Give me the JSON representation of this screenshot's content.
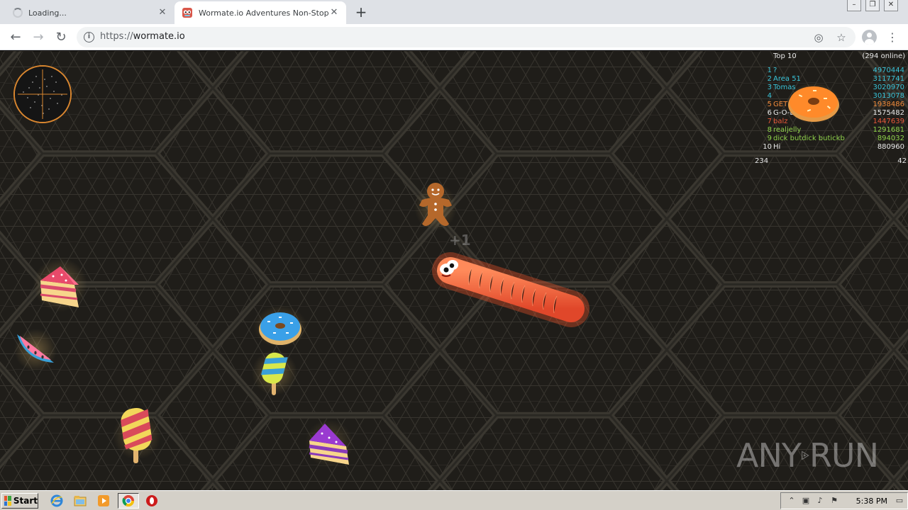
{
  "browser": {
    "tabs": [
      {
        "title": "Loading...",
        "state": "loading"
      },
      {
        "title": "Wormate.io Adventures Non-Stop",
        "state": "active"
      }
    ],
    "new_tab": "+",
    "window_controls": {
      "minimize": "–",
      "maximize": "❐",
      "close": "✕"
    },
    "nav": {
      "back": "←",
      "forward": "→",
      "reload": "↻"
    },
    "url_protocol": "https://",
    "url_host": "wormate.io",
    "info_icon": "i",
    "location_icon": "◎",
    "star_icon": "☆",
    "menu_icon": "⋮"
  },
  "game": {
    "leaderboard": {
      "title": "Top 10",
      "online": "(294 online)",
      "entries": [
        {
          "rank": "1",
          "name": "?",
          "score": "4970444",
          "color": "#39c3d8"
        },
        {
          "rank": "2",
          "name": "Area 51",
          "score": "3117741",
          "color": "#39c3d8"
        },
        {
          "rank": "3",
          "name": "Tomas",
          "score": "3020970",
          "color": "#39c3d8"
        },
        {
          "rank": "4",
          "name": "",
          "score": "3013078",
          "color": "#39c3d8"
        },
        {
          "rank": "5",
          "name": "GET",
          "score": "1938486",
          "color": "#f08a3a"
        },
        {
          "rank": "6",
          "name": "G-O-D",
          "score": "1575482",
          "color": "#e8e8e8"
        },
        {
          "rank": "7",
          "name": "balz",
          "score": "1447639",
          "color": "#e8583a"
        },
        {
          "rank": "8",
          "name": "realjelly",
          "score": "1291681",
          "color": "#8fd24b"
        },
        {
          "rank": "9",
          "name": "dick butdick butickb",
          "score": "894032",
          "color": "#8fd24b"
        },
        {
          "rank": "10",
          "name": "Hi",
          "score": "880960",
          "color": "#e8e8e8"
        }
      ],
      "footer_left": "234",
      "footer_right": "42"
    },
    "plus_one": "+1",
    "watermark": {
      "left": "ANY",
      "right": "RUN"
    }
  },
  "taskbar": {
    "start_label": "Start",
    "clock": "5:38 PM"
  }
}
